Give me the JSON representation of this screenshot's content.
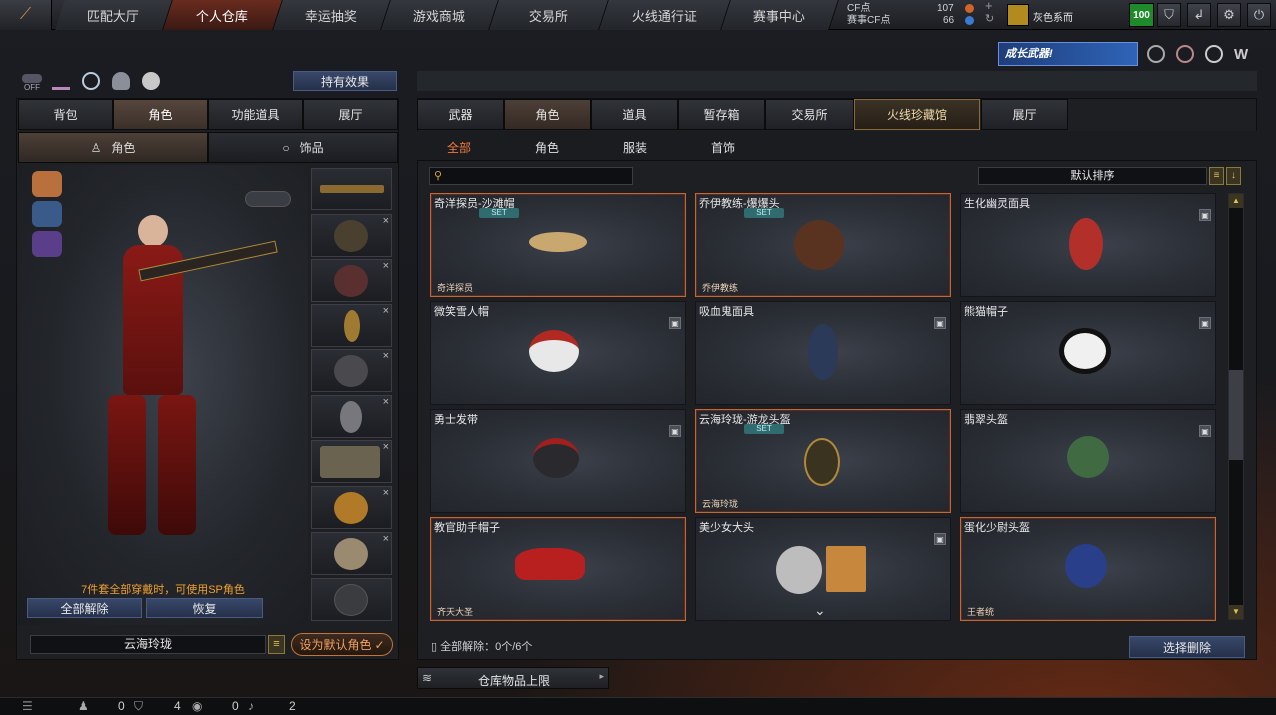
{
  "nav": {
    "tabs": [
      "匹配大厅",
      "个人仓库",
      "幸运抽奖",
      "游戏商城",
      "交易所",
      "火线通行证",
      "赛事中心"
    ],
    "active": "个人仓库"
  },
  "currency": {
    "cf_label": "CF点",
    "cf_value": "107",
    "event_label": "赛事CF点",
    "event_value": "66"
  },
  "player": {
    "rank_badge": "100",
    "name": "灰色系而"
  },
  "banner": {
    "text": "成长武器!"
  },
  "left": {
    "effects_button": "持有效果",
    "off_label": "OFF",
    "tabs": [
      "背包",
      "角色",
      "功能道具",
      "展厅"
    ],
    "active_tab": "角色",
    "subtabs": [
      "角色",
      "饰品"
    ],
    "set_notice": "7件套全部穿戴时，可使用SP角色",
    "remove_all": "全部解除",
    "restore": "恢复",
    "character_name": "云海玲珑",
    "set_default": "设为默认角色"
  },
  "right": {
    "tabs": [
      "武器",
      "角色",
      "道具",
      "暂存箱",
      "交易所",
      "火线珍藏馆",
      "展厅"
    ],
    "active_tab": "角色",
    "gold_tab": "火线珍藏馆",
    "filters": [
      "全部",
      "角色",
      "服装",
      "首饰"
    ],
    "active_filter": "全部",
    "search_placeholder": "",
    "sort": "默认排序",
    "items": [
      {
        "name": "奇洋探员-沙滩帽",
        "set": "SET",
        "owner": "奇洋探员"
      },
      {
        "name": "乔伊教练-爆爆头",
        "set": "SET",
        "owner": "乔伊教练"
      },
      {
        "name": "生化幽灵面具",
        "set": "",
        "owner": ""
      },
      {
        "name": "微笑雪人帽",
        "set": "",
        "owner": ""
      },
      {
        "name": "吸血鬼面具",
        "set": "",
        "owner": ""
      },
      {
        "name": "熊猫帽子",
        "set": "",
        "owner": ""
      },
      {
        "name": "勇士发带",
        "set": "",
        "owner": ""
      },
      {
        "name": "云海玲珑-游龙头盔",
        "set": "SET",
        "owner": "云海玲珑"
      },
      {
        "name": "翡翠头盔",
        "set": "",
        "owner": ""
      },
      {
        "name": "教官助手帽子",
        "set": "",
        "owner": "齐天大圣"
      },
      {
        "name": "美少女大头",
        "set": "",
        "owner": ""
      },
      {
        "name": "蛋化少尉头盔",
        "set": "",
        "owner": "王者统"
      }
    ],
    "remove_status": "全部解除：0个/6个",
    "select_delete": "选择删除",
    "storage_limit": "仓库物品上限"
  },
  "footer": {
    "c1": "0",
    "c2": "4",
    "c3": "0",
    "c4": "2"
  },
  "colors": {
    "accent": "#f07a38",
    "active_tab": "#6a2b1e",
    "gold": "#8a6a3a"
  }
}
